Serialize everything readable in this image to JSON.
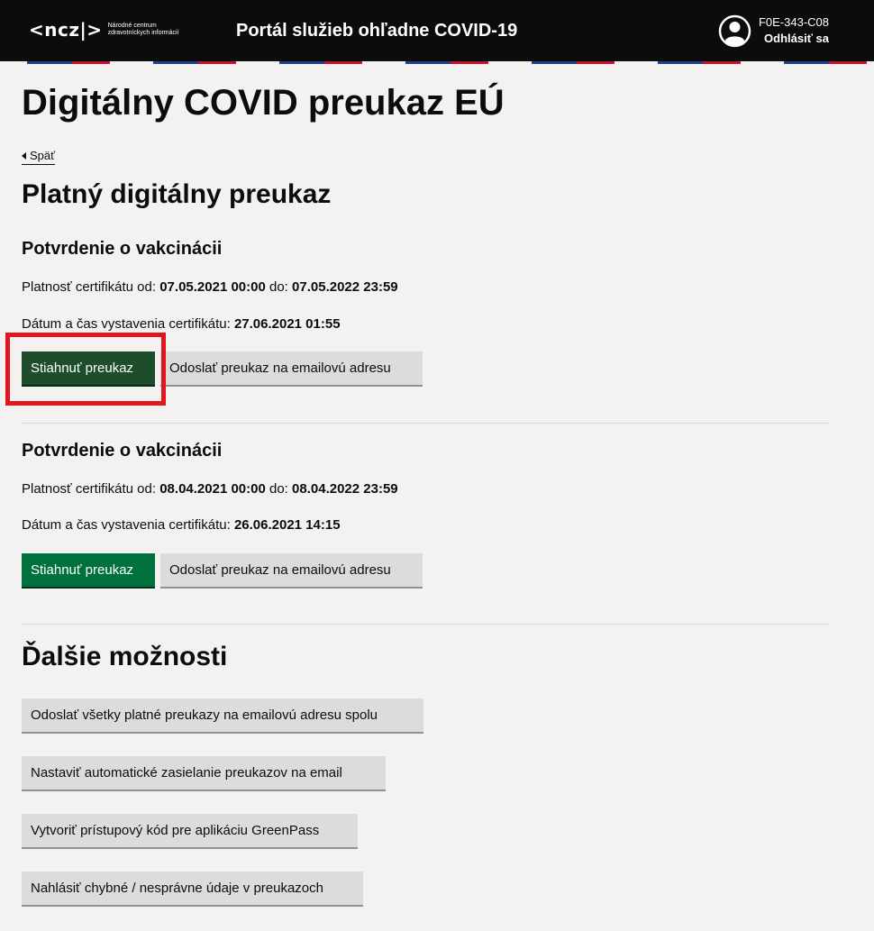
{
  "header": {
    "logo_mark": "<ncz|>",
    "logo_sub": "Národné centrum zdravotníckych informácií",
    "portal_title": "Portál služieb ohľadne COVID-19",
    "user_id": "F0E-343-C08",
    "logout_label": "Odhlásiť sa"
  },
  "page": {
    "title": "Digitálny COVID preukaz EÚ",
    "back_label": "Späť"
  },
  "valid_section": {
    "title": "Platný digitálny preukaz",
    "certificates": [
      {
        "title": "Potvrdenie o vakcinácii",
        "validity_prefix": "Platnosť certifikátu od:",
        "valid_from": "07.05.2021 00:00",
        "validity_mid": "do:",
        "valid_to": "07.05.2022 23:59",
        "issued_prefix": "Dátum a čas vystavenia certifikátu:",
        "issued_at": "27.06.2021 01:55",
        "download_label": "Stiahnuť preukaz",
        "email_label": "Odoslať preukaz na emailovú adresu"
      },
      {
        "title": "Potvrdenie o vakcinácii",
        "validity_prefix": "Platnosť certifikátu od:",
        "valid_from": "08.04.2021 00:00",
        "validity_mid": "do:",
        "valid_to": "08.04.2022 23:59",
        "issued_prefix": "Dátum a čas vystavenia certifikátu:",
        "issued_at": "26.06.2021 14:15",
        "download_label": "Stiahnuť preukaz",
        "email_label": "Odoslať preukaz na emailovú adresu"
      }
    ]
  },
  "more_section": {
    "title": "Ďalšie možnosti",
    "buttons": [
      "Odoslať všetky platné preukazy na emailovú adresu spolu",
      "Nastaviť automatické zasielanie preukazov na email",
      "Vytvoriť prístupový kód pre aplikáciu GreenPass",
      "Nahlásiť chybné / nesprávne údaje v preukazoch"
    ]
  },
  "colors": {
    "header_bg": "#0b0c0c",
    "primary_button": "#00703c",
    "secondary_button": "#dcdcdc",
    "highlight": "#e0151f"
  }
}
